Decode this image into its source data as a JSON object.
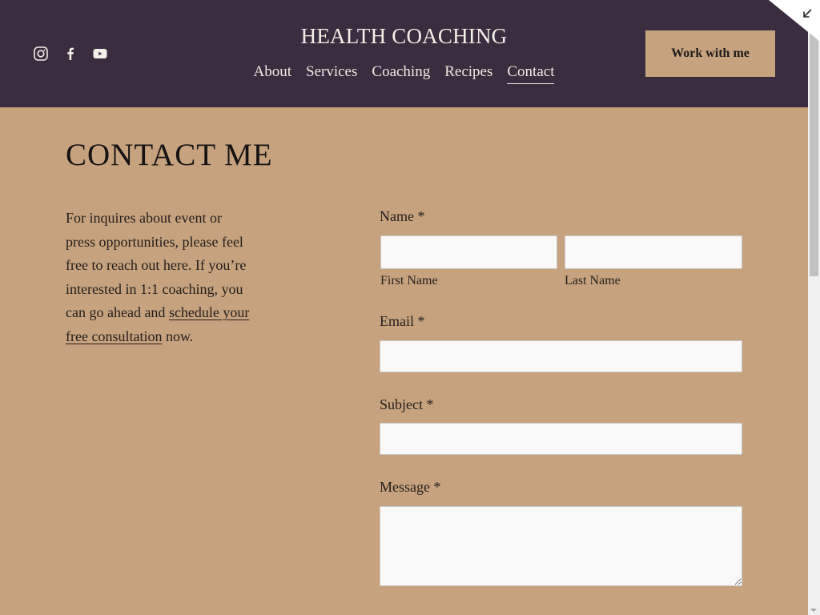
{
  "header": {
    "site_title": "HEALTH COACHING",
    "social_icons": [
      {
        "name": "instagram-icon",
        "label": "Instagram"
      },
      {
        "name": "facebook-icon",
        "label": "Facebook"
      },
      {
        "name": "youtube-icon",
        "label": "YouTube"
      }
    ],
    "nav": [
      {
        "label": "About",
        "active": false
      },
      {
        "label": "Services",
        "active": false
      },
      {
        "label": "Coaching",
        "active": false
      },
      {
        "label": "Recipes",
        "active": false
      },
      {
        "label": "Contact",
        "active": true
      }
    ],
    "cta_label": "Work with me",
    "corner_icon": "collapse-arrow-icon"
  },
  "page": {
    "title": "CONTACT ME",
    "intro_text": "For inquires about event or press opportunities, please feel free to reach out here. If you’re interested in 1:1 coaching, you can go ahead and ",
    "intro_link": "schedule your free consultation",
    "intro_end": " now."
  },
  "form": {
    "name_label": "Name *",
    "first_name_label": "First Name",
    "first_name_value": "",
    "last_name_label": "Last Name",
    "last_name_value": "",
    "email_label": "Email *",
    "email_value": "",
    "subject_label": "Subject *",
    "subject_value": "",
    "message_label": "Message *",
    "message_value": ""
  },
  "colors": {
    "header_bg": "#3a2d3f",
    "page_bg": "#c6a37e",
    "accent": "#c6a37e",
    "text": "#231d1b",
    "input_bg": "#f9f9f9"
  }
}
